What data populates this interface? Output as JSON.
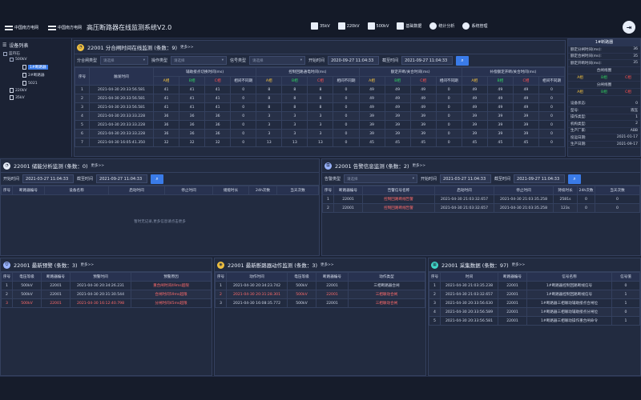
{
  "header": {
    "logo1": "中国南方电网",
    "logo2": "中国南方电网",
    "title": "高压断路器在线监测系统V2.0",
    "nav": [
      {
        "label": "35kV",
        "icon": "house-icon"
      },
      {
        "label": "220kV",
        "icon": "house-icon"
      },
      {
        "label": "500kV",
        "icon": "house-icon"
      },
      {
        "label": "基础数据",
        "icon": "database-icon"
      },
      {
        "label": "统计分析",
        "icon": "pie-chart-icon"
      },
      {
        "label": "系统管理",
        "icon": "gear-icon"
      }
    ]
  },
  "sidebar": {
    "title": "设备列表",
    "nodes": [
      "蓝丹石",
      "500kV",
      "1#断路器",
      "2#断路器",
      "5021",
      "220kV",
      "35kV"
    ]
  },
  "switch_panel": {
    "title": "22001 分合闸时间在线监测 (条数：9)",
    "more": "更多>>",
    "filter": {
      "lbl_type": "分合闸类型",
      "ph_type": "请选择",
      "lbl_op": "操作类型",
      "ph_op": "请选择",
      "lbl_sig": "信号类型",
      "ph_sig": "请选择",
      "lbl_start": "开始时间",
      "start": "2020-09-27 11:04:33",
      "lbl_end": "截至时间",
      "end": "2021-09-27 11:04:33"
    },
    "head1": [
      "序号",
      "触发时间",
      "辅助接点切换时间(ms)",
      "控制回路通电时间(ms)",
      "额定开断/关合时间(ms)",
      "补偿额定开断/关合时间(ms)"
    ],
    "head2": [
      "A相",
      "B相",
      "C相",
      "相间不同期",
      "A相",
      "B相",
      "C相",
      "相间不同期",
      "A相",
      "B相",
      "C相",
      "相间不同期",
      "A相",
      "B相",
      "C相",
      "相间不同期"
    ],
    "rows": [
      [
        "1",
        "2021-04-30 20:33:56.581",
        "41",
        "41",
        "41",
        "0",
        "8",
        "8",
        "8",
        "0",
        "49",
        "49",
        "49",
        "0",
        "49",
        "49",
        "49",
        "0"
      ],
      [
        "2",
        "2021-04-30 20:33:56.581",
        "41",
        "41",
        "41",
        "0",
        "8",
        "8",
        "8",
        "0",
        "49",
        "49",
        "49",
        "0",
        "49",
        "49",
        "49",
        "0"
      ],
      [
        "3",
        "2021-04-30 20:33:56.581",
        "41",
        "41",
        "41",
        "0",
        "8",
        "8",
        "8",
        "0",
        "49",
        "49",
        "49",
        "0",
        "49",
        "49",
        "49",
        "0"
      ],
      [
        "4",
        "2021-04-30 20:33:33.228",
        "36",
        "36",
        "36",
        "0",
        "3",
        "3",
        "3",
        "0",
        "39",
        "39",
        "39",
        "0",
        "39",
        "39",
        "39",
        "0"
      ],
      [
        "5",
        "2021-04-30 20:33:33.228",
        "36",
        "36",
        "36",
        "0",
        "3",
        "3",
        "3",
        "0",
        "39",
        "39",
        "39",
        "0",
        "39",
        "39",
        "39",
        "0"
      ],
      [
        "6",
        "2021-04-30 20:33:33.228",
        "36",
        "36",
        "36",
        "0",
        "3",
        "3",
        "3",
        "0",
        "39",
        "39",
        "39",
        "0",
        "39",
        "39",
        "39",
        "0"
      ],
      [
        "7",
        "2021-04-30 16:05:41.350",
        "32",
        "32",
        "32",
        "0",
        "13",
        "13",
        "13",
        "0",
        "45",
        "45",
        "45",
        "0",
        "45",
        "45",
        "45",
        "0"
      ]
    ]
  },
  "breaker_info": {
    "title": "1#断路器",
    "stats": [
      {
        "k": "额定分闸时间(ms):",
        "v": "36"
      },
      {
        "k": "额定合闸时间(ms):",
        "v": "35"
      },
      {
        "k": "额定开断时间(ms):",
        "v": "35"
      }
    ],
    "sec1": "合闸线圈",
    "sec2": "分闸线圈",
    "phases": [
      "A相",
      "B相",
      "C相"
    ],
    "details": [
      {
        "k": "设备状态:",
        "v": "0"
      },
      {
        "k": "型号:",
        "v": "液压"
      },
      {
        "k": "操作类型:",
        "v": "1"
      },
      {
        "k": "机构类型:",
        "v": "2"
      },
      {
        "k": "生产厂家:",
        "v": "ABB"
      },
      {
        "k": "投运日期:",
        "v": "2021-01-17"
      },
      {
        "k": "生产日期:",
        "v": "2021-09-17"
      }
    ]
  },
  "energy_panel": {
    "title": "22001 储能分析监测 (条数：0)",
    "more": "更多>>",
    "lbl_start": "开始时间",
    "start": "2021-03-27 11:04:33",
    "lbl_end": "截至时间",
    "end": "2021-09-27 11:04:33",
    "head": [
      "序号",
      "断路器编号",
      "设备名称",
      "启动时间",
      "停止时间",
      "储能时长",
      "24h次数",
      "当天次数"
    ],
    "empty": "暂时无记录,更多信息请点击更多"
  },
  "alarm_panel": {
    "title": "22001 告警信息监测 (条数：2)",
    "more": "更多>>",
    "lbl_type": "告警类型",
    "ph_type": "请选择",
    "lbl_start": "开始时间",
    "start": "2021-03-27 11:04:33",
    "lbl_end": "截至时间",
    "end": "2021-09-27 11:04:33",
    "head": [
      "序号",
      "断路器编号",
      "告警信号名称",
      "启动时间",
      "停止时间",
      "持续时长",
      "24h次数",
      "当天次数"
    ],
    "rows": [
      [
        "1",
        "22001",
        "控制回路断线告警",
        "2021-04-30 21:03:32.657",
        "2021-04-30 21:03:35.258",
        "2581s",
        "0",
        "0"
      ],
      [
        "2",
        "22001",
        "控制回路断线告警",
        "2021-04-30 21:03:32.657",
        "2021-04-30 21:03:35.258",
        "123s",
        "0",
        "0"
      ]
    ]
  },
  "warning_panel": {
    "title": "22001 最新预警 (条数：3)",
    "more": "更多>>",
    "head": [
      "序号",
      "电压等级",
      "断路器编号",
      "预警时间",
      "预警原因"
    ],
    "rows": [
      [
        "1",
        "500kV",
        "22001",
        "2021-04-30 20:34:26.231",
        "重合闸时间49ms超限"
      ],
      [
        "2",
        "500kV",
        "22001",
        "2021-04-30 20:31:30.544",
        "合闸时间59ms超限"
      ],
      [
        "3",
        "500kV",
        "22001",
        "2021-04-30 16:12:40.798",
        "分闸时间45ms超限"
      ]
    ]
  },
  "action_panel": {
    "title": "22001 最新断路器动作监测 (条数：3)",
    "more": "更多>>",
    "head": [
      "序号",
      "动作时间",
      "电压等级",
      "断路器编号",
      "动作类型"
    ],
    "rows": [
      [
        "1",
        "2021-04-30 20:34:23.742",
        "500kV",
        "22001",
        "三相断路器合闸"
      ],
      [
        "2",
        "2021-04-30 20:31:28.301",
        "500kV",
        "22001",
        "三相联动合闸"
      ],
      [
        "3",
        "2021-04-30 16:08:35.772",
        "500kV",
        "22001",
        "三相联动合闸"
      ]
    ]
  },
  "collect_panel": {
    "title": "22001 采集数据 (条数：97)",
    "more": "更多>>",
    "head": [
      "序号",
      "时间",
      "断路器编号",
      "信号名称",
      "信号值"
    ],
    "rows": [
      [
        "1",
        "2021-04-30 21:03:35.238",
        "22001",
        "1#断路器控制回路断线信号",
        "0"
      ],
      [
        "2",
        "2021-04-30 21:03:32.657",
        "22001",
        "1#断路器控制回路断线信号",
        "1"
      ],
      [
        "3",
        "2021-04-30 20:33:56.630",
        "22001",
        "1#断路器三相联动辅助接点合闸位",
        "1"
      ],
      [
        "4",
        "2021-04-30 20:33:56.589",
        "22001",
        "1#断路器三相联动辅助接点分闸位",
        "0"
      ],
      [
        "5",
        "2021-04-30 20:33:56.581",
        "22001",
        "1#断路器三相联动操作重合闸命令",
        "1"
      ]
    ]
  },
  "colors": {
    "accent": "#3a7be8",
    "phase_a": "#f0c040",
    "phase_b": "#30d060",
    "phase_c": "#ff5050"
  }
}
